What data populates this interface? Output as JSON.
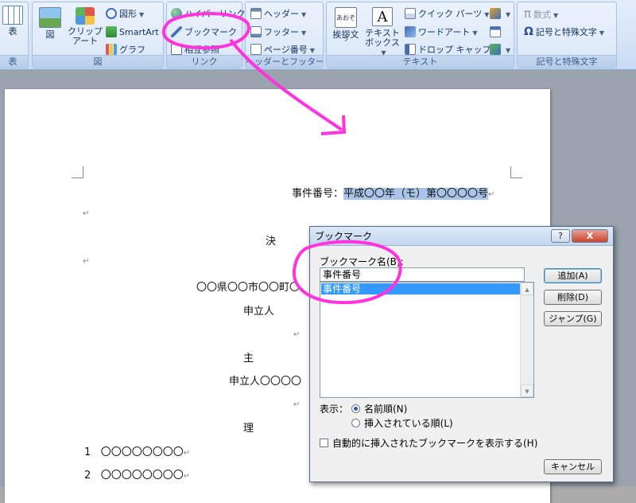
{
  "ribbon": {
    "groups": {
      "table": {
        "label": "表",
        "items": {
          "table": "表"
        }
      },
      "illustrations": {
        "label": "図",
        "items": {
          "picture": "図",
          "clipart_line1": "クリップ",
          "clipart_line2": "アート",
          "shapes": "図形",
          "smartart": "SmartArt",
          "chart": "グラフ"
        }
      },
      "links": {
        "label": "リンク",
        "items": {
          "hyperlink": "ハイパーリンク",
          "bookmark": "ブックマーク",
          "cross_reference": "相互参照"
        }
      },
      "header_footer": {
        "label": "ヘッダーとフッター",
        "items": {
          "header": "ヘッダー",
          "footer": "フッター",
          "page_number": "ページ番号"
        }
      },
      "text": {
        "label": "テキスト",
        "items": {
          "greeting_line1": "挨拶文",
          "textbox_line1": "テキスト",
          "textbox_line2": "ボックス",
          "quick_parts": "クイック パーツ",
          "wordart": "ワードアート",
          "drop_cap": "ドロップ キャップ"
        }
      },
      "symbols": {
        "label": "記号と特殊文字",
        "items": {
          "equation": "数式",
          "symbol": "記号と特殊文字"
        }
      }
    },
    "greeting_icon_text": "あおぞう",
    "textbox_icon_text": "A"
  },
  "document": {
    "case_label": "事件番号：",
    "case_value": "平成〇〇年（モ）第〇〇〇〇号",
    "heading_char": "決",
    "address": "〇〇県〇〇市〇〇町〇",
    "applicant_label": "申立人",
    "main_char": "主",
    "applicant_line": "申立人〇〇〇〇",
    "reason_char": "理",
    "item1_num": "1",
    "item1_text": "〇〇〇〇〇〇〇〇",
    "item2_num": "2",
    "item2_text": "〇〇〇〇〇〇〇〇",
    "para_mark": "↵"
  },
  "dialog": {
    "title": "ブックマーク",
    "help": "?",
    "close": "X",
    "name_label": "ブックマーク名(B):",
    "name_value": "事件番号",
    "list_items": [
      "事件番号"
    ],
    "buttons": {
      "add": "追加(A)",
      "delete": "削除(D)",
      "jump": "ジャンプ(G)",
      "cancel": "キャンセル"
    },
    "display_label": "表示：",
    "sort_by_name": "名前順(N)",
    "sort_by_location": "挿入されている順(L)",
    "show_hidden": "自動的に挿入されたブックマークを表示する(H)"
  },
  "colors": {
    "annotation": "#ff33dd",
    "selection": "#a8c4e8",
    "list_selected": "#3399ff"
  }
}
